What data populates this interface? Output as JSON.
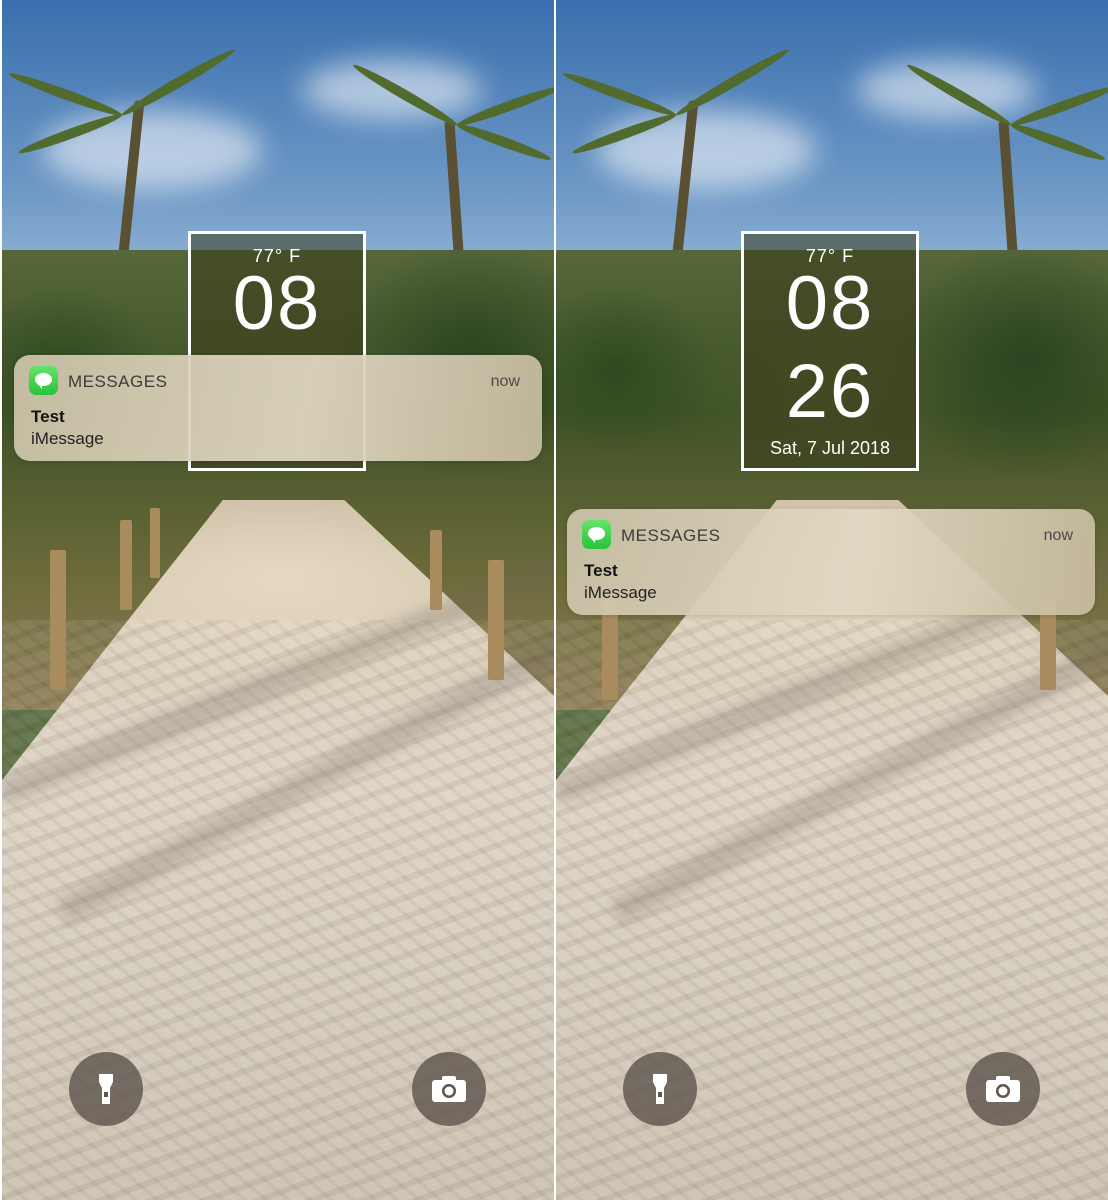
{
  "screens": [
    {
      "clock": {
        "temperature": "77° F",
        "hour": "08"
      },
      "notification": {
        "app": "MESSAGES",
        "time": "now",
        "title": "Test",
        "body": "iMessage"
      },
      "buttons": {
        "flashlight_icon": "flashlight-icon",
        "camera_icon": "camera-icon"
      }
    },
    {
      "clock": {
        "temperature": "77° F",
        "hour": "08",
        "minute": "26",
        "date": "Sat, 7 Jul 2018"
      },
      "notification": {
        "app": "MESSAGES",
        "time": "now",
        "title": "Test",
        "body": "iMessage"
      },
      "buttons": {
        "flashlight_icon": "flashlight-icon",
        "camera_icon": "camera-icon"
      }
    }
  ],
  "colors": {
    "messages_green": "#34c759",
    "widget_border": "#ffffff"
  }
}
